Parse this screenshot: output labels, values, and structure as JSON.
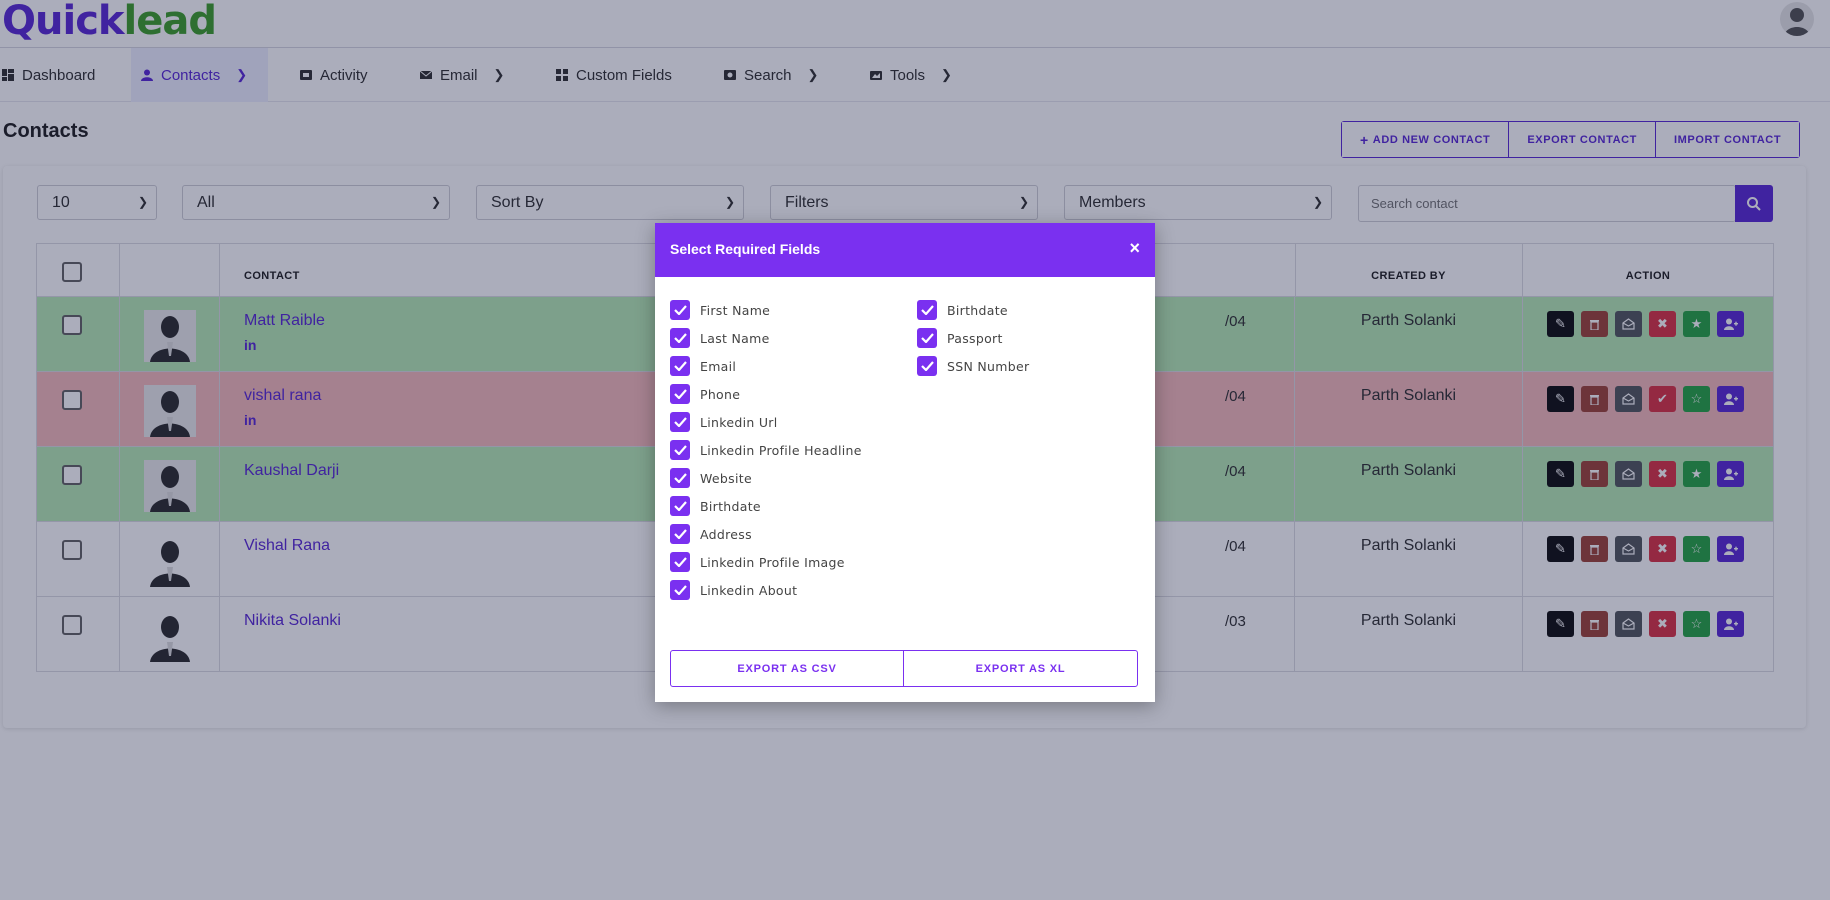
{
  "logo": {
    "part1": "Quick",
    "part2": "lead"
  },
  "nav": [
    {
      "label": "Dashboard",
      "icon": "dashboard-icon"
    },
    {
      "label": "Contacts",
      "icon": "person-icon",
      "active": true
    },
    {
      "label": "Activity",
      "icon": "activity-icon"
    },
    {
      "label": "Email",
      "icon": "mail-icon"
    },
    {
      "label": "Custom Fields",
      "icon": "grid-icon"
    },
    {
      "label": "Search",
      "icon": "search-icon"
    },
    {
      "label": "Tools",
      "icon": "tools-icon"
    }
  ],
  "page": {
    "title": "Contacts"
  },
  "actions": {
    "add": "ADD NEW CONTACT",
    "add_icon": "+",
    "export": "EXPORT CONTACT",
    "import": "IMPORT CONTACT"
  },
  "filters": {
    "per_page": "10",
    "all": "All",
    "sort": "Sort By",
    "filters": "Filters",
    "members": "Members",
    "search_placeholder": "Search contact"
  },
  "table": {
    "headers": {
      "contact": "CONTACT",
      "created_by": "CREATED BY",
      "action": "ACTION"
    },
    "rows": [
      {
        "name": "Matt Raible",
        "linkedin": "in",
        "date": "/04",
        "created_by": "Parth Solanki",
        "status": "green"
      },
      {
        "name": "vishal rana",
        "linkedin": "in",
        "date": "/04",
        "created_by": "Parth Solanki",
        "status": "red"
      },
      {
        "name": "Kaushal Darji",
        "linkedin": "",
        "date": "/04",
        "created_by": "Parth Solanki",
        "status": "green"
      },
      {
        "name": "Vishal Rana",
        "linkedin": "",
        "date": "/04",
        "created_by": "Parth Solanki",
        "status": "white"
      },
      {
        "name": "Nikita Solanki",
        "linkedin": "",
        "date": "/03",
        "created_by": "Parth Solanki",
        "status": "white"
      }
    ]
  },
  "modal": {
    "title": "Select Required Fields",
    "close": "×",
    "left_fields": [
      "First Name",
      "Last Name",
      "Email",
      "Phone",
      "Linkedin Url",
      "Linkedin Profile Headline",
      "Website",
      "Birthdate",
      "Address",
      "Linkedin Profile Image",
      "Linkedin About"
    ],
    "right_fields": [
      "Birthdate",
      "Passport",
      "SSN Number"
    ],
    "export_csv": "EXPORT AS CSV",
    "export_xl": "EXPORT AS XL"
  },
  "colors": {
    "primary": "#5b2bd6",
    "modal_header": "#7a30f0",
    "green_row": "#b9ebb6",
    "red_row": "#f6bcbc"
  }
}
